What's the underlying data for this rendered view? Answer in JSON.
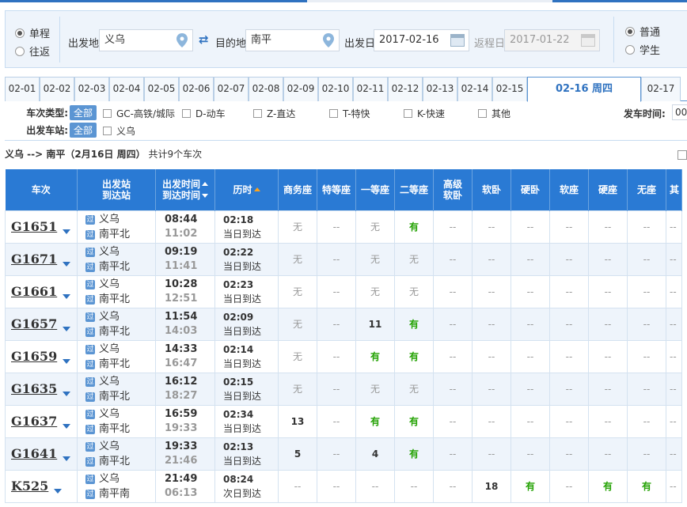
{
  "trip": {
    "one_way": "单程",
    "round_trip": "往返"
  },
  "from": {
    "label": "出发地",
    "value": "义乌"
  },
  "to": {
    "label": "目的地",
    "value": "南平"
  },
  "depart": {
    "label": "出发日",
    "value": "2017-02-16"
  },
  "return": {
    "label": "返程日",
    "value": "2017-01-22"
  },
  "passenger": {
    "normal": "普通",
    "student": "学生"
  },
  "dates": [
    "02-01",
    "02-02",
    "02-03",
    "02-04",
    "02-05",
    "02-06",
    "02-07",
    "02-08",
    "02-09",
    "02-10",
    "02-11",
    "02-12",
    "02-13",
    "02-14",
    "02-15"
  ],
  "active_date": "02-16 周四",
  "next_date": "02-17",
  "filters": {
    "type_label": "车次类型:",
    "all": "全部",
    "types": [
      "GC-高铁/城际",
      "D-动车",
      "Z-直达",
      "T-特快",
      "K-快速",
      "其他"
    ],
    "station_label": "出发车站:",
    "stations": [
      "义乌"
    ],
    "depart_time_label": "发车时间:",
    "depart_time_value": "00"
  },
  "summary": {
    "route": "义乌 --> 南平（2月16日  周四）",
    "count": "共计9个车次"
  },
  "headers": {
    "train": "车次",
    "station_from": "出发站",
    "station_to": "到达站",
    "time_dep": "出发时间",
    "time_arr": "到达时间",
    "duration": "历时",
    "seats": [
      "商务座",
      "特等座",
      "一等座",
      "二等座",
      "高级\n软卧",
      "软卧",
      "硬卧",
      "软座",
      "硬座",
      "无座",
      "其"
    ]
  },
  "trains": [
    {
      "no": "G1651",
      "from": "义乌",
      "to": "南平北",
      "dep": "08:44",
      "arr": "11:02",
      "dur": "02:18",
      "day": "当日到达",
      "seats": [
        "无",
        "--",
        "无",
        "有",
        "--",
        "--",
        "--",
        "--",
        "--",
        "--",
        "--"
      ]
    },
    {
      "no": "G1671",
      "from": "义乌",
      "to": "南平北",
      "dep": "09:19",
      "arr": "11:41",
      "dur": "02:22",
      "day": "当日到达",
      "seats": [
        "无",
        "--",
        "无",
        "无",
        "--",
        "--",
        "--",
        "--",
        "--",
        "--",
        "--"
      ]
    },
    {
      "no": "G1661",
      "from": "义乌",
      "to": "南平北",
      "dep": "10:28",
      "arr": "12:51",
      "dur": "02:23",
      "day": "当日到达",
      "seats": [
        "无",
        "--",
        "无",
        "无",
        "--",
        "--",
        "--",
        "--",
        "--",
        "--",
        "--"
      ]
    },
    {
      "no": "G1657",
      "from": "义乌",
      "to": "南平北",
      "dep": "11:54",
      "arr": "14:03",
      "dur": "02:09",
      "day": "当日到达",
      "seats": [
        "无",
        "--",
        "11",
        "有",
        "--",
        "--",
        "--",
        "--",
        "--",
        "--",
        "--"
      ]
    },
    {
      "no": "G1659",
      "from": "义乌",
      "to": "南平北",
      "dep": "14:33",
      "arr": "16:47",
      "dur": "02:14",
      "day": "当日到达",
      "seats": [
        "无",
        "--",
        "有",
        "有",
        "--",
        "--",
        "--",
        "--",
        "--",
        "--",
        "--"
      ]
    },
    {
      "no": "G1635",
      "from": "义乌",
      "to": "南平北",
      "dep": "16:12",
      "arr": "18:27",
      "dur": "02:15",
      "day": "当日到达",
      "seats": [
        "无",
        "--",
        "无",
        "无",
        "--",
        "--",
        "--",
        "--",
        "--",
        "--",
        "--"
      ]
    },
    {
      "no": "G1637",
      "from": "义乌",
      "to": "南平北",
      "dep": "16:59",
      "arr": "19:33",
      "dur": "02:34",
      "day": "当日到达",
      "seats": [
        "13",
        "--",
        "有",
        "有",
        "--",
        "--",
        "--",
        "--",
        "--",
        "--",
        "--"
      ]
    },
    {
      "no": "G1641",
      "from": "义乌",
      "to": "南平北",
      "dep": "19:33",
      "arr": "21:46",
      "dur": "02:13",
      "day": "当日到达",
      "seats": [
        "5",
        "--",
        "4",
        "有",
        "--",
        "--",
        "--",
        "--",
        "--",
        "--",
        "--"
      ]
    },
    {
      "no": "K525",
      "from": "义乌",
      "to": "南平南",
      "dep": "21:49",
      "arr": "06:13",
      "dur": "08:24",
      "day": "次日到达",
      "seats": [
        "--",
        "--",
        "--",
        "--",
        "--",
        "18",
        "有",
        "--",
        "有",
        "有",
        "--"
      ]
    }
  ],
  "pass_icon": "过",
  "colors": {
    "header": "#2a7ad4",
    "accent": "#2f72c0",
    "available": "#26a306"
  }
}
